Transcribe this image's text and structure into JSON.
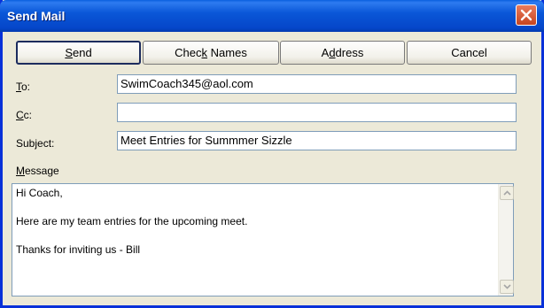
{
  "window": {
    "title": "Send Mail"
  },
  "toolbar": {
    "send_label_pre": "",
    "send_label_acc": "S",
    "send_label_post": "end",
    "check_names_pre": "Chec",
    "check_names_acc": "k",
    "check_names_post": " Names",
    "address_pre": "A",
    "address_acc": "d",
    "address_post": "dress",
    "cancel_label": "Cancel"
  },
  "fields": {
    "to_label_acc": "T",
    "to_label_post": "o:",
    "to_value": "SwimCoach345@aol.com",
    "cc_label_acc": "C",
    "cc_label_post": "c:",
    "cc_value": "",
    "subject_label": "Subject:",
    "subject_value": "Meet Entries for Summmer Sizzle"
  },
  "message": {
    "label_acc": "M",
    "label_post": "essage",
    "lines": [
      "Hi Coach,",
      "",
      "Here are my team entries for the upcoming meet.",
      "",
      "Thanks for inviting us - Bill"
    ]
  },
  "colors": {
    "titlebar": "#0A57D8",
    "dialog_bg": "#ECE9D8",
    "field_border": "#7F9DB9",
    "close_button": "#C74520"
  },
  "icons": {
    "close": "close-icon",
    "scroll_up": "scroll-up-arrow-icon",
    "scroll_down": "scroll-down-arrow-icon"
  }
}
